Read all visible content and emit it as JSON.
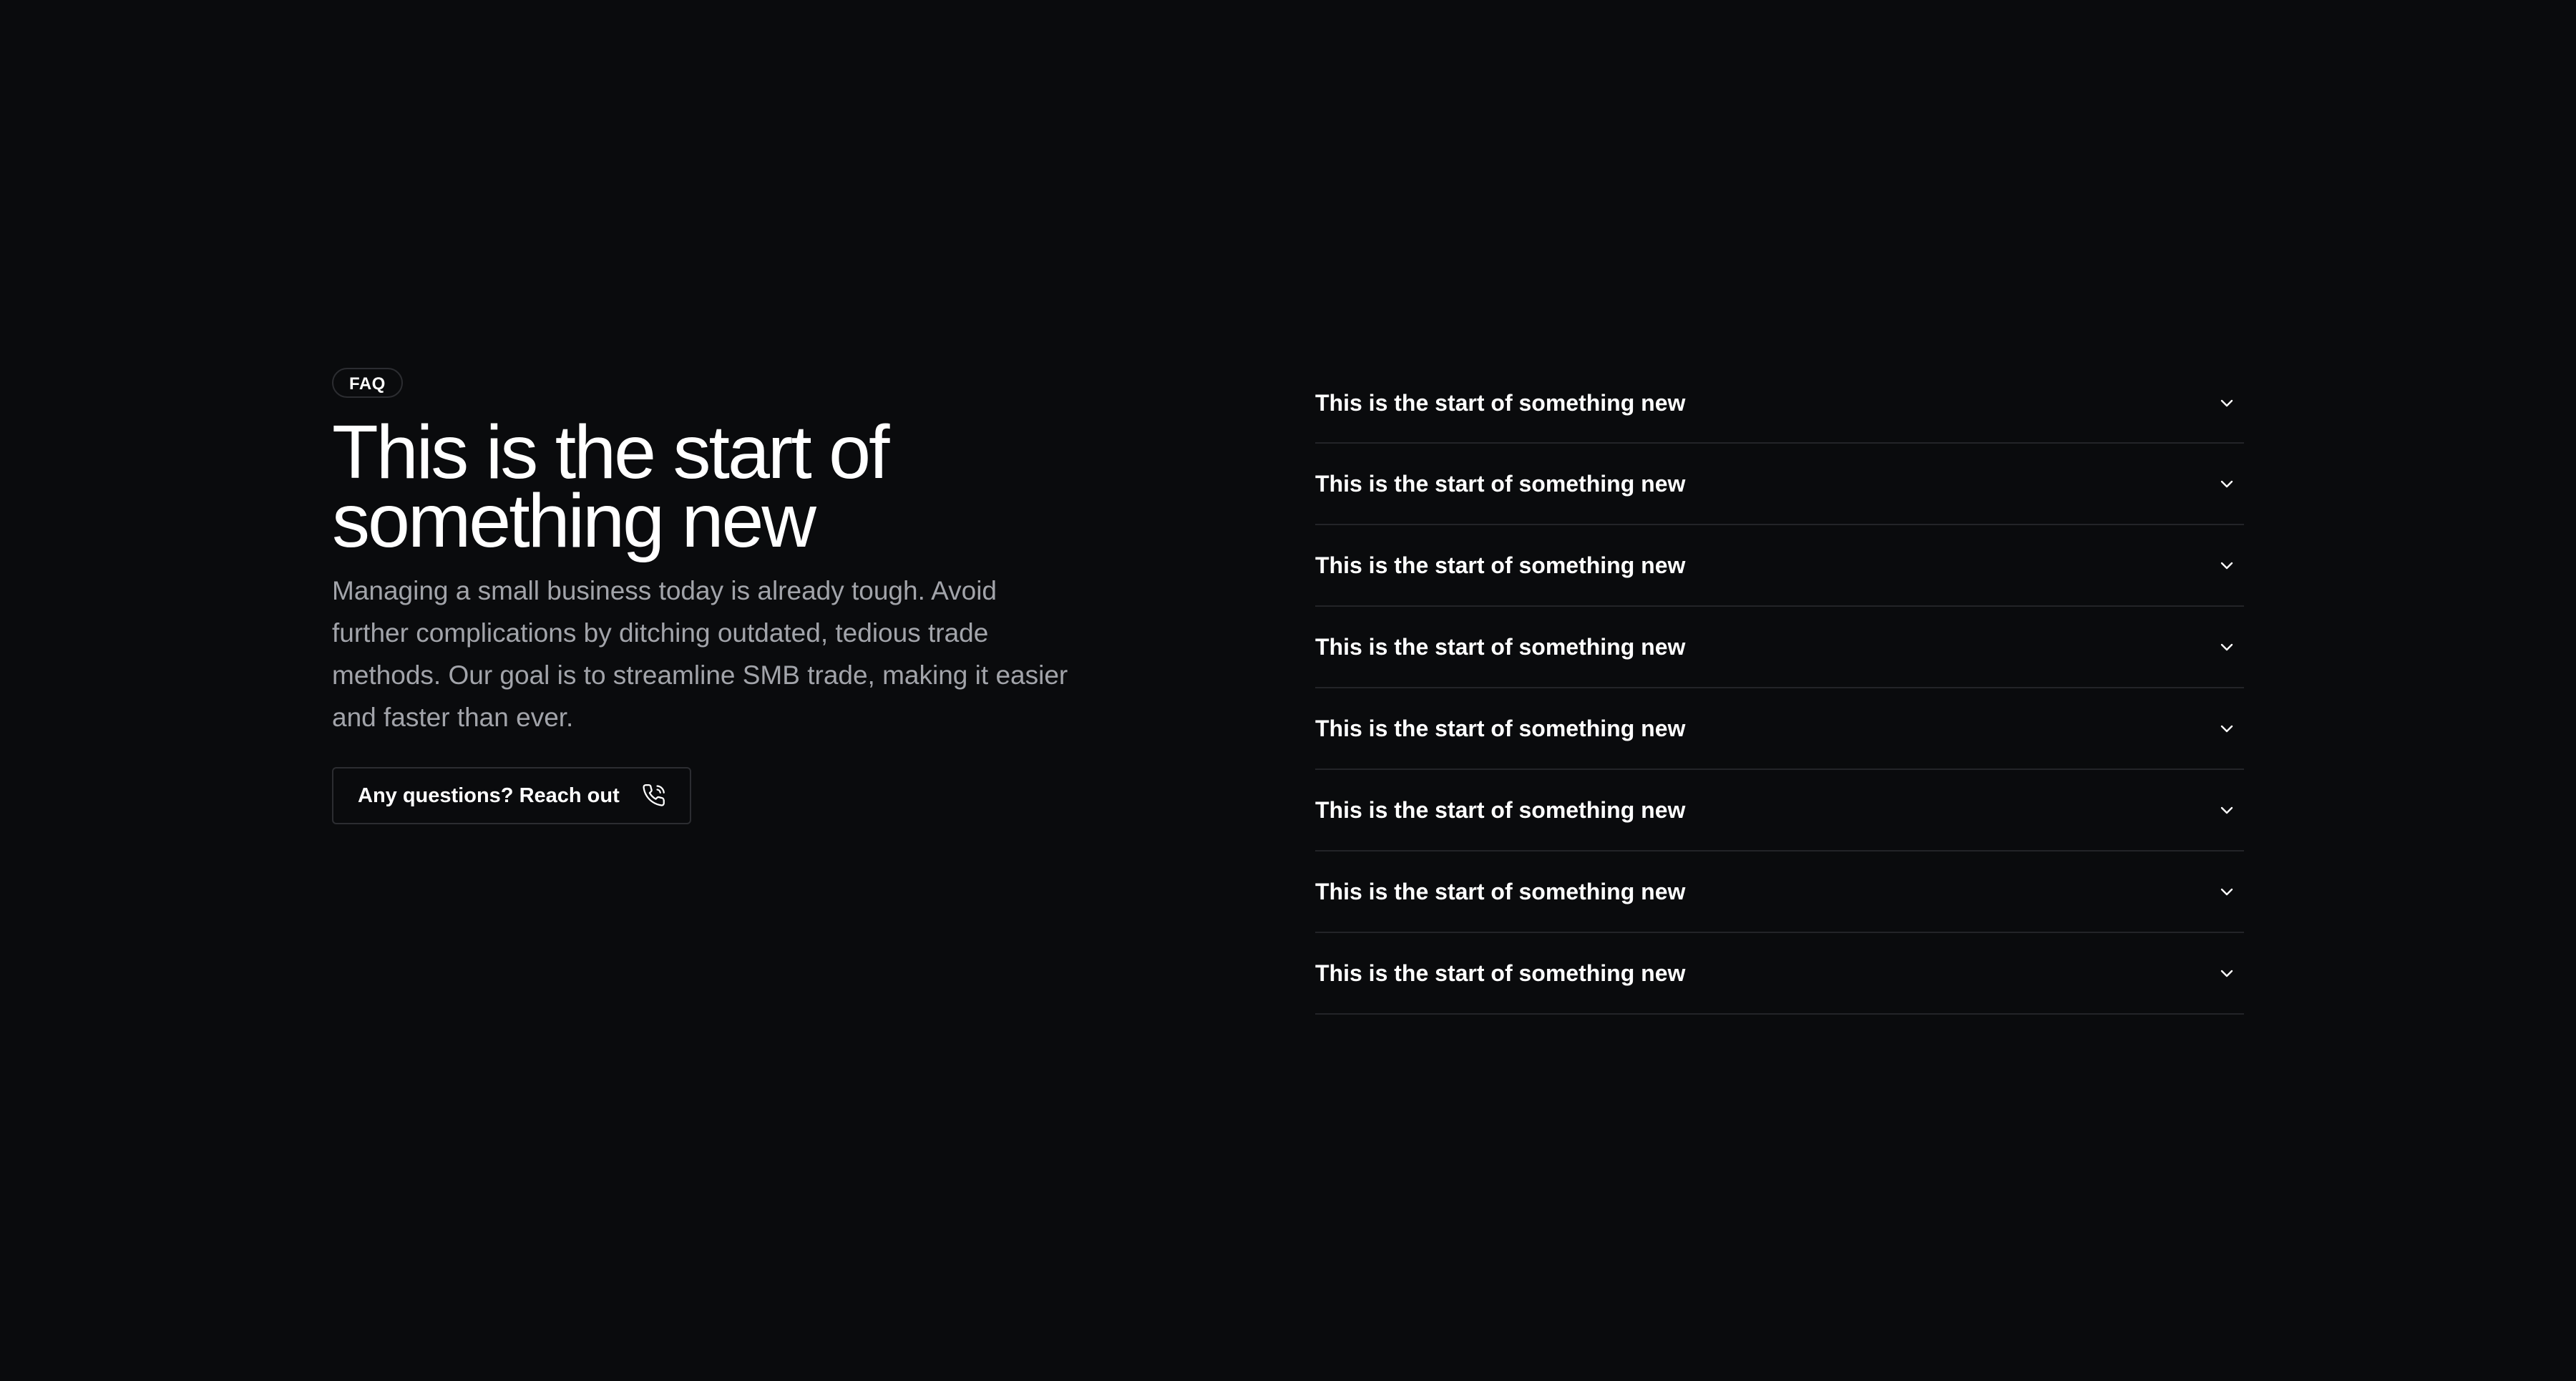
{
  "badge": "FAQ",
  "title": "This is the start of something new",
  "description": "Managing a small business today is already tough. Avoid further complications by ditching outdated, tedious trade methods. Our goal is to streamline SMB trade, making it easier and faster than ever.",
  "cta": {
    "label": "Any questions? Reach out",
    "icon": "phone-icon"
  },
  "faq": [
    {
      "question": "This is the start of something new",
      "icon": "chevron-down-icon"
    },
    {
      "question": "This is the start of something new",
      "icon": "chevron-down-icon"
    },
    {
      "question": "This is the start of something new",
      "icon": "chevron-down-icon"
    },
    {
      "question": "This is the start of something new",
      "icon": "chevron-down-icon"
    },
    {
      "question": "This is the start of something new",
      "icon": "chevron-down-icon"
    },
    {
      "question": "This is the start of something new",
      "icon": "chevron-down-icon"
    },
    {
      "question": "This is the start of something new",
      "icon": "chevron-down-icon"
    },
    {
      "question": "This is the start of something new",
      "icon": "chevron-down-icon"
    }
  ],
  "colors": {
    "background": "#0a0b0d",
    "text": "#ffffff",
    "muted": "#a2a4aa",
    "border": "#2c2d31"
  }
}
